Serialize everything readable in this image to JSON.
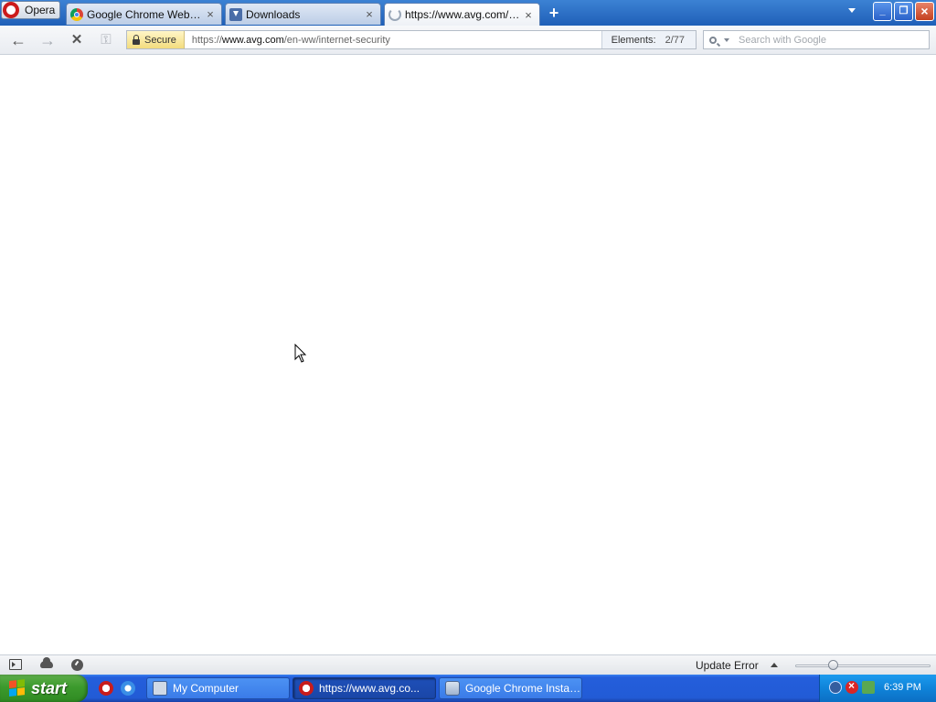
{
  "browser": {
    "menu_label": "Opera",
    "tabs": [
      {
        "title": "Google Chrome Web Bro...",
        "close": "×"
      },
      {
        "title": "Downloads",
        "close": "×"
      },
      {
        "title": "https://www.avg.com/e...",
        "close": "×",
        "loading": true
      }
    ],
    "new_tab": "+",
    "window_buttons": {
      "minimize": "_",
      "restore": "❐",
      "close": "×"
    }
  },
  "navbar": {
    "back": "←",
    "forward": "→",
    "stop": "✕",
    "key": "⚿",
    "secure_label": "Secure",
    "url_scheme": "https://",
    "url_domain": "www.avg.com",
    "url_path": "/en-ww/internet-security",
    "elements_label": "Elements:",
    "elements_value": "2/77",
    "search_placeholder": "Search with Google"
  },
  "statusbar": {
    "update_text": "Update Error",
    "zoom_level": 0.28
  },
  "taskbar": {
    "start_label": "start",
    "tasks": [
      {
        "label": "My Computer",
        "icon": "my-computer-icon"
      },
      {
        "label": "https://www.avg.co...",
        "icon": "opera-icon",
        "active": true
      },
      {
        "label": "Google Chrome Installer",
        "icon": "installer-icon"
      }
    ],
    "clock": "6:39 PM"
  },
  "colors": {
    "taskbar_blue": "#245edb",
    "start_green": "#3c9a2d",
    "secure_yellow": "#f3dc7d"
  }
}
